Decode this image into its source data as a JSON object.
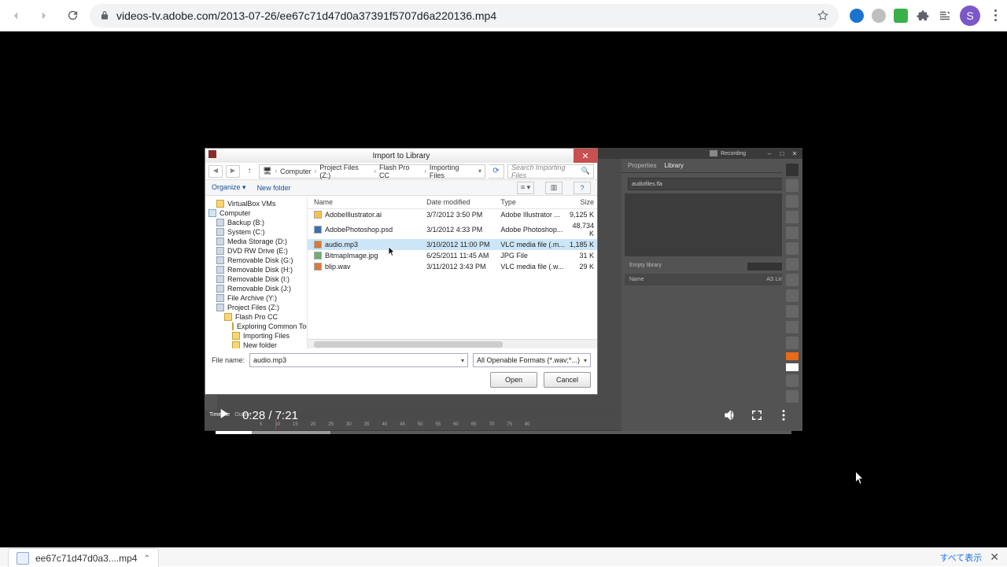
{
  "browser": {
    "url": "videos-tv.adobe.com/2013-07-26/ee67c71d47d0a37391f5707d6a220136.mp4",
    "avatar_letter": "S"
  },
  "video": {
    "current_time": "0:28",
    "duration": "7:21",
    "played_fraction": 0.063,
    "buffered_fraction": 0.2
  },
  "flash_app": {
    "recording_label": "Recording",
    "panel_tabs": {
      "properties": "Properties",
      "library": "Library"
    },
    "library_file": "audiofiles.fla",
    "empty_library": "Empty library",
    "col_name": "Name",
    "col_linkage": "AS Linkage",
    "timeline_tabs": {
      "timeline": "Timeline",
      "output": "Output"
    },
    "timeline_ticks": [
      "5",
      "10",
      "15",
      "20",
      "25",
      "30",
      "35",
      "40",
      "45",
      "50",
      "55",
      "60",
      "65",
      "70",
      "75",
      "80"
    ]
  },
  "dialog": {
    "title": "Import to Library",
    "breadcrumb": [
      "Computer",
      "Project Files (Z:)",
      "Flash Pro CC",
      "Importing Files"
    ],
    "search_placeholder": "Search Importing Files",
    "organize": "Organize",
    "new_folder": "New folder",
    "columns": {
      "name": "Name",
      "date": "Date modified",
      "type": "Type",
      "size": "Size"
    },
    "tree": [
      {
        "label": "VirtualBox VMs",
        "indent": 1,
        "cls": "fold"
      },
      {
        "label": "Computer",
        "indent": 0,
        "cls": "pc"
      },
      {
        "label": "Backup (B:)",
        "indent": 1,
        "cls": "drv"
      },
      {
        "label": "System (C:)",
        "indent": 1,
        "cls": "drv"
      },
      {
        "label": "Media Storage (D:)",
        "indent": 1,
        "cls": "drv"
      },
      {
        "label": "DVD RW Drive (E:)",
        "indent": 1,
        "cls": "drv"
      },
      {
        "label": "Removable Disk (G:)",
        "indent": 1,
        "cls": "drv"
      },
      {
        "label": "Removable Disk (H:)",
        "indent": 1,
        "cls": "drv"
      },
      {
        "label": "Removable Disk (I:)",
        "indent": 1,
        "cls": "drv"
      },
      {
        "label": "Removable Disk (J:)",
        "indent": 1,
        "cls": "drv"
      },
      {
        "label": "File Archive (Y:)",
        "indent": 1,
        "cls": "drv"
      },
      {
        "label": "Project Files (Z:)",
        "indent": 1,
        "cls": "drv"
      },
      {
        "label": "Flash Pro CC",
        "indent": 2,
        "cls": "fold"
      },
      {
        "label": "Exploring Common Tools",
        "indent": 3,
        "cls": "fold"
      },
      {
        "label": "Importing Files",
        "indent": 3,
        "cls": "fold"
      },
      {
        "label": "New folder",
        "indent": 3,
        "cls": "fold"
      }
    ],
    "files": [
      {
        "name": "AdobeIllustrator.ai",
        "date": "3/7/2012 3:50 PM",
        "type": "Adobe Illustrator ...",
        "size": "9,125 K",
        "cls": "ai",
        "selected": false
      },
      {
        "name": "AdobePhotoshop.psd",
        "date": "3/1/2012 4:33 PM",
        "type": "Adobe Photoshop...",
        "size": "48,734 K",
        "cls": "psd",
        "selected": false
      },
      {
        "name": "audio.mp3",
        "date": "3/10/2012 11:00 PM",
        "type": "VLC media file (.m...",
        "size": "1,185 K",
        "cls": "aud",
        "selected": true
      },
      {
        "name": "BitmapImage.jpg",
        "date": "6/25/2011 11:45 AM",
        "type": "JPG File",
        "size": "31 K",
        "cls": "jpg",
        "selected": false
      },
      {
        "name": "blip.wav",
        "date": "3/11/2012 3:43 PM",
        "type": "VLC media file (.w...",
        "size": "29 K",
        "cls": "aud",
        "selected": false
      }
    ],
    "file_name_label": "File name:",
    "file_name_value": "audio.mp3",
    "filter_label": "All Openable Formats (*.wav;*...)",
    "open": "Open",
    "cancel": "Cancel"
  },
  "download": {
    "filename": "ee67c71d47d0a3....mp4",
    "show_all": "すべて表示"
  }
}
